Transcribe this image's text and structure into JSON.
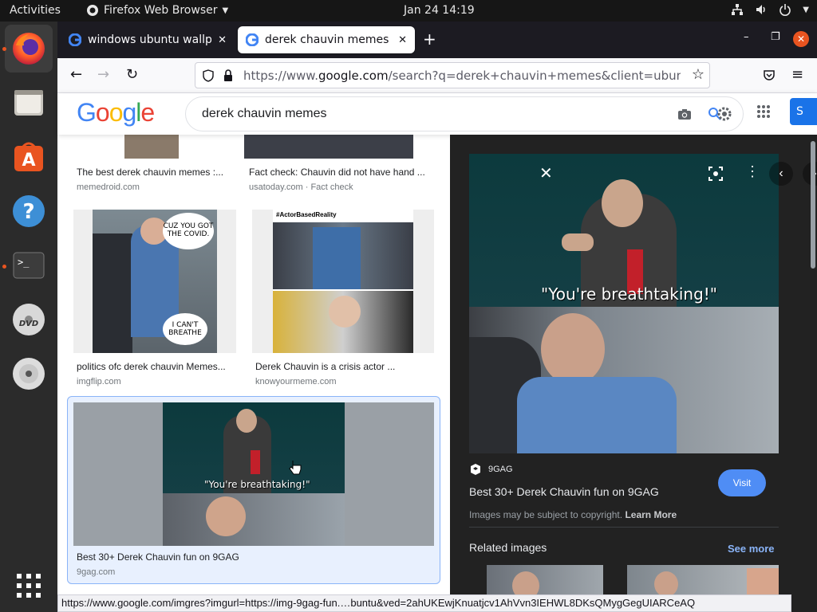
{
  "topbar": {
    "activities": "Activities",
    "app_menu": "Firefox Web Browser",
    "clock": "Jan 24  14:19"
  },
  "dock": {
    "items": [
      {
        "name": "firefox",
        "icon": "firefox-icon"
      },
      {
        "name": "files",
        "icon": "files-icon"
      },
      {
        "name": "software",
        "icon": "software-center-icon"
      },
      {
        "name": "help",
        "icon": "help-icon"
      },
      {
        "name": "terminal",
        "icon": "terminal-icon"
      },
      {
        "name": "dvd",
        "icon": "dvd-icon"
      },
      {
        "name": "disc",
        "icon": "disc-icon"
      },
      {
        "name": "apps",
        "icon": "show-apps-icon"
      }
    ]
  },
  "browser": {
    "tabs": [
      {
        "title": "windows ubuntu wallpap",
        "active": false
      },
      {
        "title": "derek chauvin memes - G",
        "active": true
      }
    ],
    "url_prefix": "https://www.",
    "url_domain": "google.com",
    "url_rest": "/search?q=derek+chauvin+memes&client=ubuntu&hs"
  },
  "google": {
    "logo": "Google",
    "query": "derek chauvin memes",
    "signin_label": "S"
  },
  "results": [
    {
      "title": "The best derek chauvin memes :...",
      "source": "memedroid.com"
    },
    {
      "title": "Fact check: Chauvin did not have hand ...",
      "source": "usatoday.com · Fact check"
    },
    {
      "title": "politics ofc derek chauvin Memes...",
      "source": "imgflip.com"
    },
    {
      "title": "Derek Chauvin is a crisis actor ...",
      "source": "knowyourmeme.com"
    },
    {
      "title": "Best 30+ Derek Chauvin fun on 9GAG",
      "source": "9gag.com"
    }
  ],
  "memes": {
    "covid_bubble": "CUZ YOU GOT THE COVID.",
    "breathe_bubble": "I CAN'T BREATHE",
    "actor_tag": "#ActorBasedReality",
    "breathtaking": "\"You're breathtaking!\""
  },
  "preview": {
    "site_name": "9GAG",
    "title": "Best 30+ Derek Chauvin fun on 9GAG",
    "visit_label": "Visit",
    "copyright_text": "Images may be subject to copyright.",
    "learn_more": "Learn More",
    "related_label": "Related images",
    "see_more": "See more"
  },
  "statusbar": {
    "text": "https://www.google.com/imgres?imgurl=https://img-9gag-fun.…buntu&ved=2ahUKEwjKnuatjcv1AhVvn3IEHWL8DKsQMygGegUIARCeAQ"
  },
  "colors": {
    "ubuntu_orange": "#e95420",
    "google_blue": "#1a73e8",
    "visit_button": "#4f8df5"
  }
}
